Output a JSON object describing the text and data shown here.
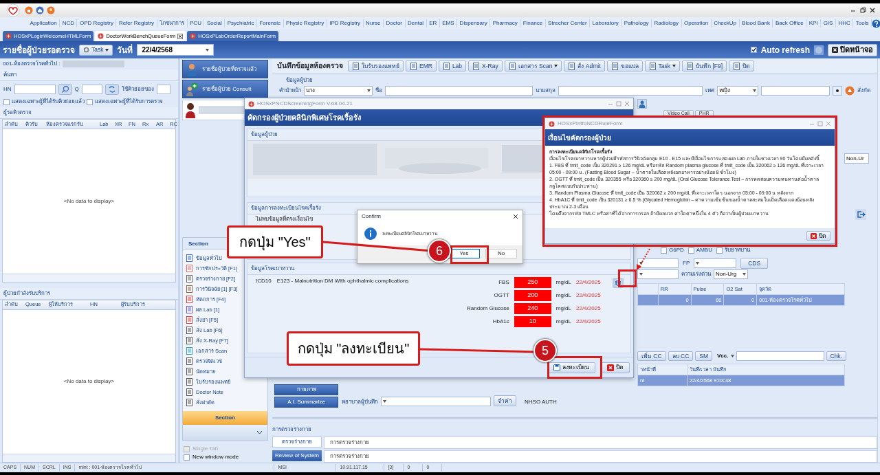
{
  "menu": [
    "Application",
    "NCD",
    "OPD Registry",
    "Refer Registry",
    "โภชนาการ",
    "PCU",
    "Social",
    "Psychiatric",
    "Forensic",
    "Physic Registry",
    "IPD Registry",
    "Nurse",
    "Doctor",
    "Dental",
    "ER",
    "EMS",
    "Dispensary",
    "Pharmacy",
    "Finance",
    "Strecher Center",
    "Laboratory",
    "Pathology",
    "Radiology",
    "Operation",
    "CheckUp",
    "Blood Bank",
    "Back Office",
    "KPI",
    "GIS",
    "HHC",
    "Tools"
  ],
  "doc_tabs": [
    {
      "label": "HOSxPLoginWelcomeHTMLForm",
      "selected": false,
      "closable": false
    },
    {
      "label": "DoctorWorkBenchQueueForm",
      "selected": true,
      "closable": true
    },
    {
      "label": "HOSxPLabOrderReportMainForm",
      "selected": false,
      "closable": false
    }
  ],
  "header": {
    "title": "รายชื่อผู้ป่วยรอตรวจ",
    "task_button": "Task",
    "date_label": "วันที่",
    "date": "22/4/2568",
    "auto_refresh": {
      "label": "Auto refresh",
      "checked": true
    },
    "close_button": "ปิดหน้าจอ"
  },
  "left_panel": {
    "room": "001-ห้องตรวจโรคทั่วไป :",
    "search_title": "ค้นหา",
    "hn_label": "HN",
    "q_label": "Q",
    "subqueue_label": "ใช้คิวย่อยของ",
    "filters": [
      {
        "label": "แสดงเฉพาะผู้ที่ได้รับคิวย่อยแล้ว",
        "checked": false
      },
      {
        "label": "แสดงเฉพาะผู้ที่ได้รับการตรวจ",
        "checked": false
      }
    ],
    "waiting": {
      "title": "ผู้รอคิวตรวจ",
      "columns": [
        "ลำดับ",
        "คิวรับ",
        "ห้องตรวจแรกรับ",
        "Lab",
        "XR",
        "FN",
        "Rx",
        "AR",
        "RC"
      ],
      "empty": "<No data to display>"
    },
    "serving": {
      "title": "ผู้ป่วยกำลังรับบริการ",
      "columns": [
        "ลำดับ",
        "Queue",
        "ผู้ให้บริการ",
        "HN",
        "ผู้รับบริการ"
      ],
      "empty": "<No data to display>"
    }
  },
  "nav_buttons": [
    "รายชื่อผู้ป่วยที่ตรวจแล้ว",
    "รายชื่อผู้ป่วย Consult"
  ],
  "section": {
    "title": "Section",
    "items": [
      "ข้อมูลทั่วไป",
      "การซักประวัติ [F1]",
      "ตรวจร่างกาย [F2]",
      "การวินิจฉัย [1] [F3]",
      "หัตถการ [F4]",
      "ผล Lab [1]",
      "สั่งยา [F5]",
      "สั่ง Lab [F6]",
      "สั่ง X-Ray [F7]",
      "เอกสาร Scan",
      "ตรวจจิตเวช",
      "นัดหมาย",
      "ใบรับรองแพทย์",
      "Doctor Note",
      "สั่งผ่าตัด"
    ],
    "footer": "Section",
    "options": [
      {
        "label": "Single Tab",
        "checked": false,
        "disabled": true
      },
      {
        "label": "New window mode",
        "checked": false,
        "disabled": false
      }
    ]
  },
  "toolbar": {
    "title": "บันทึกข้อมูลห้องตรวจ",
    "buttons": [
      {
        "label": "ใบรับรองแพทย์",
        "dropdown": false
      },
      {
        "label": "EMR",
        "dropdown": false
      },
      {
        "label": "Lab",
        "dropdown": false
      },
      {
        "label": "X-Ray",
        "dropdown": false
      },
      {
        "label": "เอกสาร Scan",
        "dropdown": true
      },
      {
        "label": "สั่ง Admit",
        "dropdown": false
      },
      {
        "label": "ขอแปล",
        "dropdown": false
      },
      {
        "label": "Task",
        "dropdown": true
      },
      {
        "label": "บันทึก [F9]",
        "dropdown": false
      },
      {
        "label": "ปิด",
        "dropdown": false
      }
    ]
  },
  "patient": {
    "title": "ข้อมูลผู้ป่วย",
    "prefix_label": "คำนำหน้า",
    "prefix": "นาง",
    "name_label": "ชื่อ",
    "surname_label": "นามสกุล",
    "sex_label": "เพศ",
    "sex": "หญิง",
    "order_label": "สั่งกัด"
  },
  "side_panel": {
    "video_call": "Video Call",
    "phr": "PHR",
    "priority_value": "Non-Ur",
    "flags": [
      {
        "label": "G6PD",
        "checked": false
      },
      {
        "label": "AMBU",
        "checked": false
      },
      {
        "label": "รับยาทบาน",
        "checked": false
      }
    ],
    "fp_label": "FP",
    "cds_button": "CDS",
    "urgency_label": "ความเร่งด่วน",
    "urgency": "Non-Urg",
    "vitals": {
      "columns": [
        "RR",
        "Pulse",
        "O2 Sat",
        "จุดวัด"
      ],
      "rows": [
        {
          "cells": [
            "0",
            "80",
            "0",
            "001-ห้องตรวจโรคทั่วไป"
          ],
          "selected": true
        }
      ]
    },
    "cc_buttons": [
      "เพิ่ม CC",
      "ลบ CC",
      "SM"
    ],
    "vcc_label": "Vcc.",
    "chk_button": "Chk.",
    "records": {
      "columns": [
        "าหน้าที่",
        "วันที่/เวลา บันทึก"
      ],
      "rows": [
        {
          "cells": [
            "nt",
            "22/4/2568 9:03:48"
          ],
          "selected": true
        }
      ]
    }
  },
  "lower": {
    "side_buttons": [
      "กายภาพ",
      "A.I. Summarize"
    ],
    "nurse_label": "พยาบาลผู้บันทึก",
    "remember_button": "จำค่า",
    "nhso": "NHSO AUTH"
  },
  "exam": {
    "title": "การตรวจร่างกาย",
    "tabs": [
      {
        "label": "ตรวจร่างกาย",
        "selected": true
      },
      {
        "label": "Review of System",
        "selected": false
      }
    ],
    "texts": [
      "การตรวจร่างกาย",
      "การตรวจร่างกาย"
    ]
  },
  "status_bar": [
    "CAPS",
    "NUM",
    "SCRL",
    "INS",
    "mint : 001-ห้องตรวจโรคทั่วไป",
    "MSI",
    "10.91.117.15",
    "[3]",
    "0",
    "0"
  ],
  "screening_dialog": {
    "window_title": "HOSxPNCDScreeningForm V.68.04.21",
    "header": "คัดกรองผู้ป่วยคลินิกพิเศษโรคเรื้อรัง",
    "patient_group": "ข้อมูลผู้ป่วย",
    "registration_group": "ข้อมูลการลงทะเบียนโรคเรื้อรัง",
    "registration_note": "ไม่พบข้อมูลที่ตรงเงื่อนไข",
    "diabetes_group": "ข้อมูลโรคเบาหวาน",
    "icd_label": "ICD10",
    "diagnosis": "E123 - Malnutrition DM With ophthalmic complications",
    "labs": [
      {
        "name": "FBS",
        "value": "250",
        "unit": "mg/dL",
        "date": "22/4/2025"
      },
      {
        "name": "OGTT",
        "value": "200",
        "unit": "mg/dL",
        "date": "22/4/2025"
      },
      {
        "name": "Random Glucose",
        "value": "240",
        "unit": "mg/dL",
        "date": "22/4/2025"
      },
      {
        "name": "HbA1c",
        "value": "10",
        "unit": "mg/dL",
        "date": "22/4/2025"
      }
    ],
    "register_button": "ลงทะเบียน",
    "close_button": "ปิด"
  },
  "rule_dialog": {
    "window_title": "HOSxPIntfoNCDRuleForm",
    "header": "เงื่อนไขคัดกรองผู้ป่วย",
    "heading": "การลงทะเบียนคลินิกโรคเรื้อรัง",
    "lines": [
      "เงื่อนไขโรคเบาหวานหากผู้ป่วยมีรหัสการวินิจฉัยกลุ่ม E10 - E15 และมีเงื่อนไขการแสดงผล Lab ภายในช่วงเวลา 90 วันโดยมีผลดังนี้",
      "1. FBS ที่ tmlt_code เป็น 320291 ≥ 126 mg/dL หรือรหัส Random plasma glucose ที่ tmlt_code เป็น 320062 ≥ 126 mg/dL ที่เจาะเวลา 05:00 - 09:00 น. (Fasting Blood Sugar – น้ำตาลในเลือดหลังอดอาหารอย่างน้อย 8 ชั่วโมง)",
      "2. OGTT ที่ tmlt_code เป็น 320355 หรือ 320360 ≥ 200 mg/dL (Oral Glucose Tolerance Test – การทดสอบความทนทานต่อน้ำตาลกลูโคสแบบรับประทาน)",
      "3. Random Plasma Glucose ที่ tmlt_code เป็น 320062 ≥ 200 mg/dL ที่เจาะเวลาใดๆ นอกจาก 05:00 - 09:00 น หลังจาก",
      "4. HbA1C ที่ tmlt_code เป็น 320131 ≥ 6.5 % (Glycated Hemoglobin – ค่าความเข้มข้นของน้ำตาลสะสมในเม็ดเลือดแดงย้อนหลังประมาณ 2-3 เดือน",
      "โดยดึงจากรหัส TMLC หรือค่าที่ได้จากการกรอก ถ้ามีผลบวก ค่าใดค่าหนึ่งใน 4 ตัว ถือว่าเป็นผู้ป่วยเบาหวาน"
    ],
    "close_button": "ปิด"
  },
  "confirm_dialog": {
    "title": "Confirm",
    "message": "ลงทะเบียนคลินิกโรคเบาหวาน",
    "buttons": [
      {
        "label": "Yes",
        "selected": true
      },
      {
        "label": "No",
        "selected": false
      }
    ]
  },
  "callouts": [
    {
      "text": "กดปุ่ม \"Yes\"",
      "step": "6"
    },
    {
      "text": "กดปุ่ม \"ลงทะเบียน\"",
      "step": "5"
    }
  ]
}
